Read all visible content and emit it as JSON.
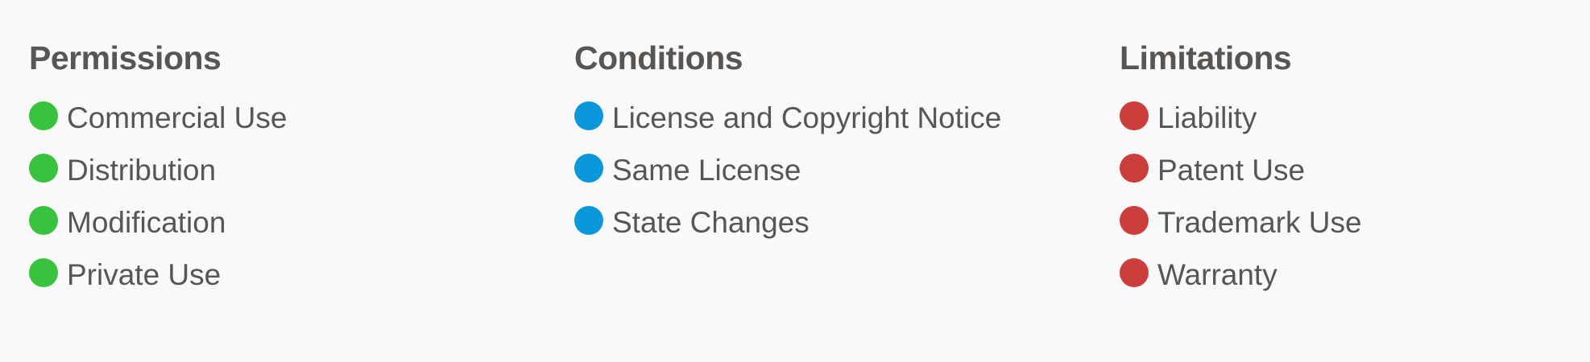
{
  "columns": [
    {
      "title": "Permissions",
      "color": "#38c23d",
      "items": [
        "Commercial Use",
        "Distribution",
        "Modification",
        "Private Use"
      ]
    },
    {
      "title": "Conditions",
      "color": "#0a98db",
      "items": [
        "License and Copyright Notice",
        "Same License",
        "State Changes"
      ]
    },
    {
      "title": "Limitations",
      "color": "#cb3e3b",
      "items": [
        "Liability",
        "Patent Use",
        "Trademark Use",
        "Warranty"
      ]
    }
  ]
}
